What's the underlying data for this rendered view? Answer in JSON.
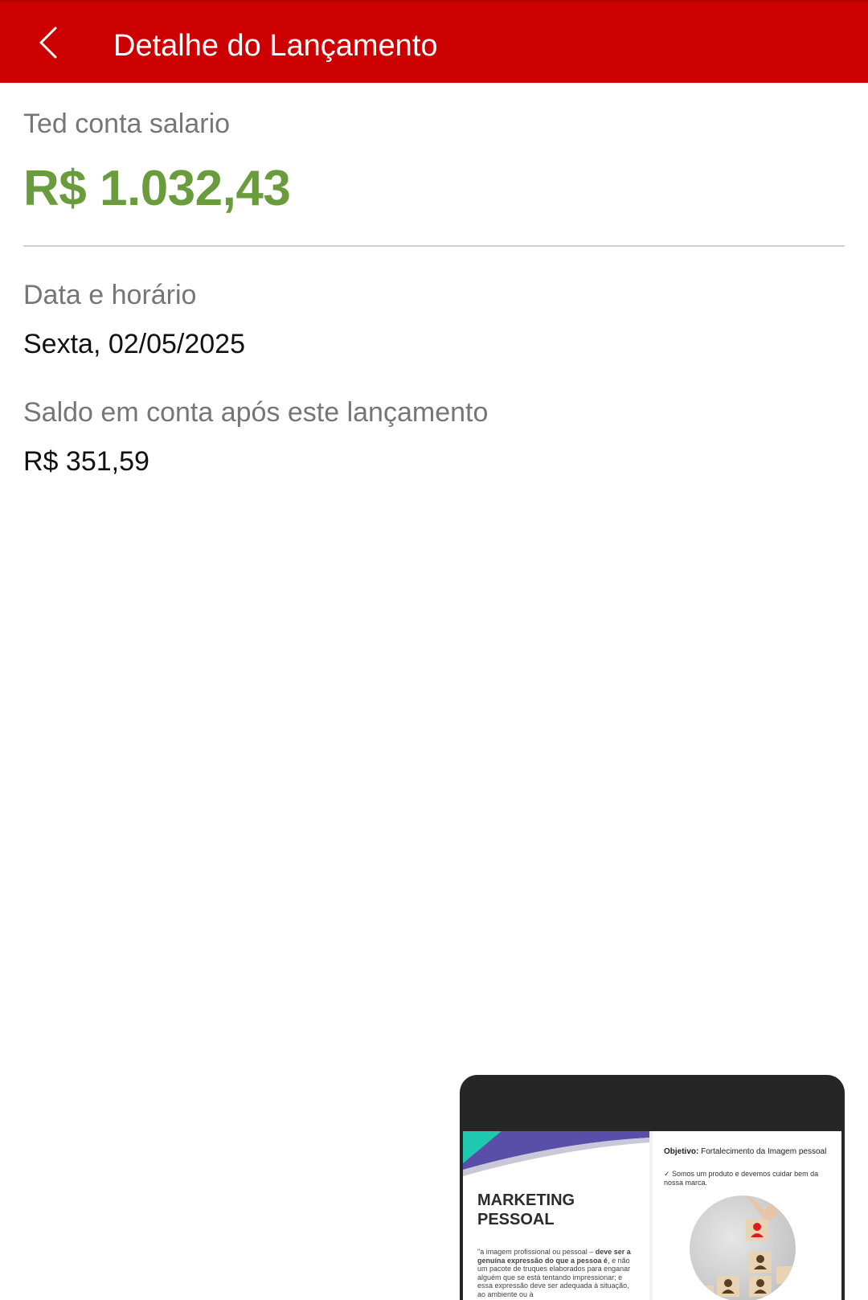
{
  "header": {
    "back_icon": "chevron-left-icon",
    "title": "Detalhe do Lançamento"
  },
  "transaction": {
    "description": "Ted conta salario",
    "amount": "R$ 1.032,43",
    "date_label": "Data e horário",
    "date_value": "Sexta, 02/05/2025",
    "balance_label": "Saldo em conta após este lançamento",
    "balance_value": "R$ 351,59"
  },
  "colors": {
    "header_bg": "#cc0000",
    "amount_green": "#6a9c3d",
    "label_gray": "#767676"
  },
  "preview": {
    "left_slide": {
      "title_line1": "MARKETING",
      "title_line2": "PESSOAL",
      "body_normal_1": "\"a imagem profissional ou pessoal – ",
      "body_bold": "deve ser a genuína expressão do que a pessoa é",
      "body_normal_2": ", e não um pacote de truques elaborados para enganar alguém que se está tentando impressionar; e essa expressão deve ser adequada à situação, ao ambiente ou à"
    },
    "right_slide": {
      "objective_label": "Objetivo:",
      "objective_text": " Fortalecimento da Imagem pessoal",
      "check_item": "✓ Somos um produto e devemos cuidar bem da nossa marca."
    }
  }
}
